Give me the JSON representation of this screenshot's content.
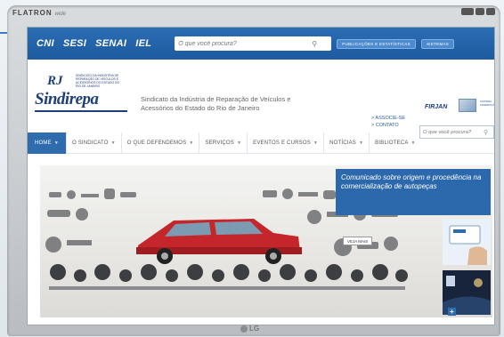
{
  "monitor": {
    "brand": "FLATRON",
    "brand_sub": "wide",
    "maker": "LG"
  },
  "topbar": {
    "system_links": [
      "CNI",
      "SESI",
      "SENAI",
      "IEL"
    ],
    "search_placeholder": "O que você procura?",
    "pills": [
      "PUBLICAÇÕES E ESTATÍSTICAS",
      "SISTEMAS"
    ]
  },
  "header": {
    "logo_rj": "RJ",
    "logo_name": "Sindirepa",
    "logo_small": "SINDICATO DA INDÚSTRIA DE REPARAÇÃO DE VEÍCULOS E ACESSÓRIOS DO ESTADO DO RIO DE JANEIRO",
    "org_name": "Sindicato da Indústria de Reparação de Veículos e Acessórios do Estado do Rio de Janeiro",
    "links": [
      "> ASSOCIE-SE",
      "> CONTATO"
    ],
    "firjan": "FIRJAN",
    "mini_logo": "SISTEMA FEDERAÇÃO",
    "search_placeholder": "O que você procura?"
  },
  "nav": {
    "items": [
      {
        "label": "HOME",
        "active": true
      },
      {
        "label": "O SINDICATO",
        "active": false
      },
      {
        "label": "O QUE DEFENDEMOS",
        "active": false
      },
      {
        "label": "SERVIÇOS",
        "active": false
      },
      {
        "label": "EVENTOS E CURSOS",
        "active": false
      },
      {
        "label": "NOTÍCIAS",
        "active": false
      },
      {
        "label": "BIBLIOTECA",
        "active": false
      }
    ]
  },
  "hero": {
    "caption": "Comunicado sobre origem e procedência na comercialização de autopeças",
    "see_more": "VEJA MAIS"
  },
  "colors": {
    "primary": "#2c6db4",
    "nav_active": "#2e6cae",
    "brand_dark": "#1f3f7a"
  }
}
